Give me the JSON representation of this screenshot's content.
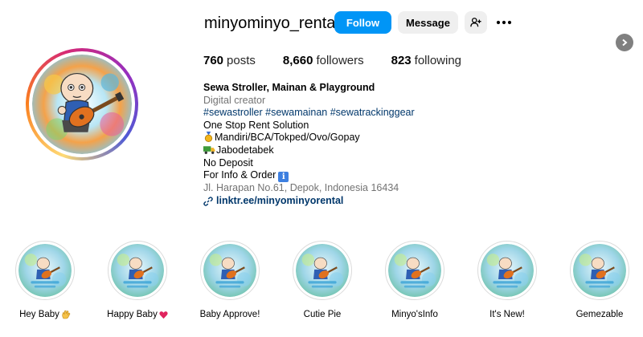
{
  "profile": {
    "username": "minyominyo_rental",
    "follow_label": "Follow",
    "message_label": "Message"
  },
  "stats": {
    "posts_count": "760",
    "posts_label": "posts",
    "followers_count": "8,660",
    "followers_label": "followers",
    "following_count": "823",
    "following_label": "following"
  },
  "bio": {
    "name": "Sewa Stroller, Mainan & Playground",
    "category": "Digital creator",
    "hashtags": "#sewastroller #sewamainan #sewatrackinggear",
    "line1": "One Stop Rent Solution",
    "line2": "Mandiri/BCA/Tokped/Ovo/Gopay",
    "line3": "Jabodetabek",
    "line4": "No Deposit",
    "line5": "For Info & Order",
    "info_emoji": "i",
    "address": "Jl. Harapan No.61, Depok, Indonesia 16434",
    "link": "linktr.ee/minyominyorental"
  },
  "highlights": [
    {
      "label": "Hey Baby",
      "emoji": "hand"
    },
    {
      "label": "Happy Baby",
      "emoji": "heart"
    },
    {
      "label": "Baby Approve!",
      "emoji": ""
    },
    {
      "label": "Cutie Pie",
      "emoji": ""
    },
    {
      "label": "Minyo'sInfo",
      "emoji": ""
    },
    {
      "label": "It's New!",
      "emoji": ""
    },
    {
      "label": "Gemezable",
      "emoji": ""
    }
  ],
  "colors": {
    "follow_button": "#0095f6",
    "secondary_button": "#efefef",
    "link": "#00376b",
    "muted_text": "#737373"
  }
}
